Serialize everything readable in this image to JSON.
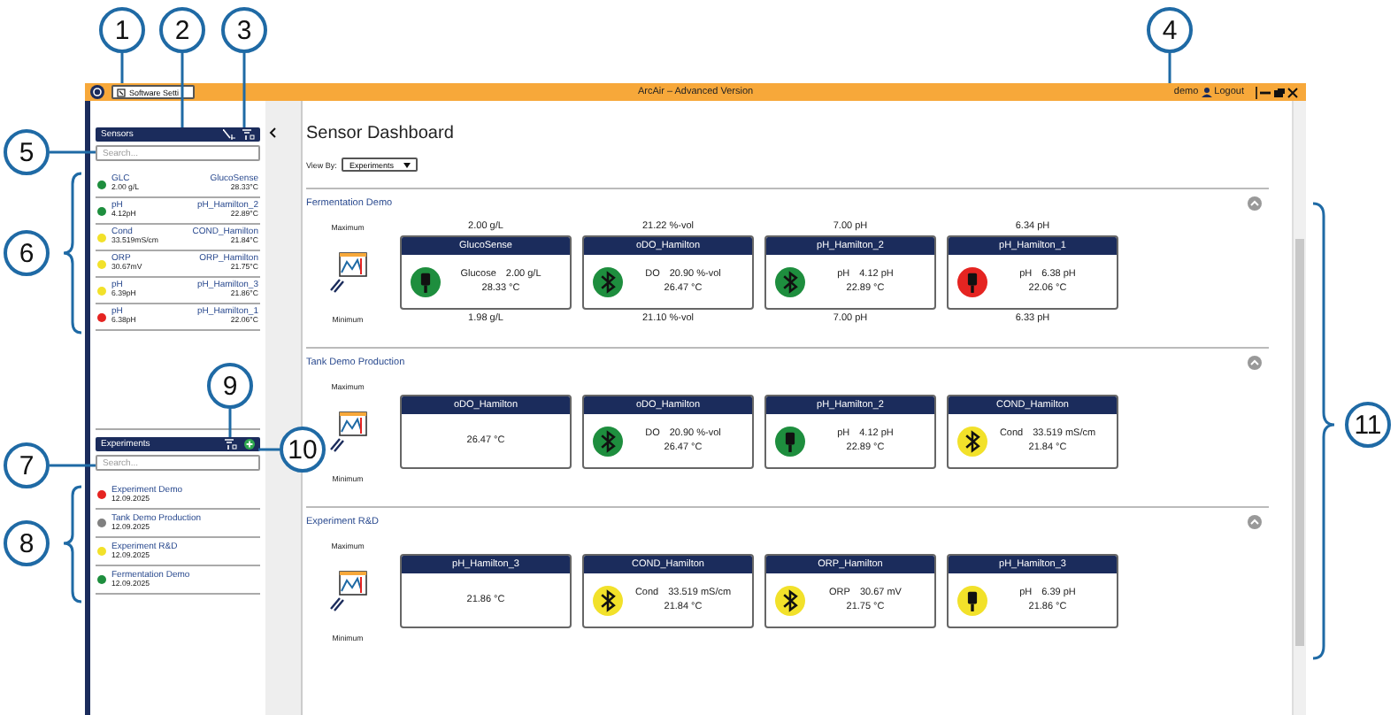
{
  "callouts": [
    {
      "number": "1"
    },
    {
      "number": "2"
    },
    {
      "number": "3"
    },
    {
      "number": "4"
    },
    {
      "number": "5"
    },
    {
      "number": "6"
    },
    {
      "number": "7"
    },
    {
      "number": "8"
    },
    {
      "number": "9"
    },
    {
      "number": "10"
    },
    {
      "number": "11"
    }
  ],
  "window": {
    "tab": "Software Setti",
    "title": "ArcAir – Advanced Version",
    "user": "demo",
    "logout": "Logout"
  },
  "sensors": {
    "title": "Sensors",
    "search": {
      "placeholder": "Search..."
    },
    "items": [
      {
        "name": "GLC",
        "value": "2.00 g/L",
        "device": "GlucoSense",
        "temperature": "28.33°C",
        "color": "#1e8e3e"
      },
      {
        "name": "pH",
        "value": "4.12pH",
        "device": "pH_Hamilton_2",
        "temperature": "22.89°C",
        "color": "#1e8e3e"
      },
      {
        "name": "Cond",
        "value": "33.519mS/cm",
        "device": "COND_Hamilton",
        "temperature": "21.84°C",
        "color": "#f2e12a"
      },
      {
        "name": "ORP",
        "value": "30.67mV",
        "device": "ORP_Hamilton",
        "temperature": "21.75°C",
        "color": "#f2e12a"
      },
      {
        "name": "pH",
        "value": "6.39pH",
        "device": "pH_Hamilton_3",
        "temperature": "21.86°C",
        "color": "#f2e12a"
      },
      {
        "name": "pH",
        "value": "6.38pH",
        "device": "pH_Hamilton_1",
        "temperature": "22.06°C",
        "color": "#e52421"
      }
    ]
  },
  "experiments": {
    "title": "Experiments",
    "search": {
      "placeholder": "Search..."
    },
    "items": [
      {
        "name": "Experiment Demo",
        "date": "12.09.2025",
        "color": "#e52421"
      },
      {
        "name": "Tank Demo Production",
        "date": "12.09.2025",
        "color": "#808080"
      },
      {
        "name": "Experiment R&D",
        "date": "12.09.2025",
        "color": "#f2e12a"
      },
      {
        "name": "Fermentation Demo",
        "date": "12.09.2025",
        "color": "#1e8e3e"
      }
    ]
  },
  "dashboard": {
    "title": "Sensor Dashboard",
    "view_by": {
      "label": "View By:",
      "value": "Experiments"
    },
    "sections": [
      {
        "title": "Fermentation Demo",
        "max_label": "Maximum",
        "min_label": "Minimum",
        "cards": [
          {
            "title": "GlucoSense",
            "kind": "usb",
            "color": "#1e8e3e",
            "parameter": "Glucose",
            "value": "2.00 g/L",
            "temperature": "28.33 °C",
            "max": "2.00 g/L",
            "min": "1.98 g/L"
          },
          {
            "title": "oDO_Hamilton",
            "kind": "bluetooth",
            "color": "#1e8e3e",
            "parameter": "DO",
            "value": "20.90 %-vol",
            "temperature": "26.47 °C",
            "max": "21.22 %-vol",
            "min": "21.10 %-vol"
          },
          {
            "title": "pH_Hamilton_2",
            "kind": "bluetooth",
            "color": "#1e8e3e",
            "parameter": "pH",
            "value": "4.12 pH",
            "temperature": "22.89 °C",
            "max": "7.00 pH",
            "min": "7.00 pH"
          },
          {
            "title": "pH_Hamilton_1",
            "kind": "usb",
            "color": "#e52421",
            "parameter": "pH",
            "value": "6.38 pH",
            "temperature": "22.06 °C",
            "max": "6.34 pH",
            "min": "6.33 pH"
          }
        ]
      },
      {
        "title": "Tank Demo Production",
        "max_label": "Maximum",
        "min_label": "Minimum",
        "cards": [
          {
            "title": "oDO_Hamilton",
            "kind": "none",
            "temperature": "26.47 °C"
          },
          {
            "title": "oDO_Hamilton",
            "kind": "bluetooth",
            "color": "#1e8e3e",
            "parameter": "DO",
            "value": "20.90 %-vol",
            "temperature": "26.47 °C"
          },
          {
            "title": "pH_Hamilton_2",
            "kind": "usb",
            "color": "#1e8e3e",
            "parameter": "pH",
            "value": "4.12 pH",
            "temperature": "22.89 °C"
          },
          {
            "title": "COND_Hamilton",
            "kind": "bluetooth",
            "color": "#f2e12a",
            "parameter": "Cond",
            "value": "33.519 mS/cm",
            "temperature": "21.84 °C"
          }
        ]
      },
      {
        "title": "Experiment R&D",
        "max_label": "Maximum",
        "min_label": "Minimum",
        "cards": [
          {
            "title": "pH_Hamilton_3",
            "kind": "none",
            "temperature": "21.86 °C"
          },
          {
            "title": "COND_Hamilton",
            "kind": "bluetooth",
            "color": "#f2e12a",
            "parameter": "Cond",
            "value": "33.519 mS/cm",
            "temperature": "21.84 °C"
          },
          {
            "title": "ORP_Hamilton",
            "kind": "bluetooth",
            "color": "#f2e12a",
            "parameter": "ORP",
            "value": "30.67 mV",
            "temperature": "21.75 °C"
          },
          {
            "title": "pH_Hamilton_3",
            "kind": "usb",
            "color": "#f2e12a",
            "parameter": "pH",
            "value": "6.39 pH",
            "temperature": "21.86 °C"
          }
        ]
      }
    ]
  }
}
